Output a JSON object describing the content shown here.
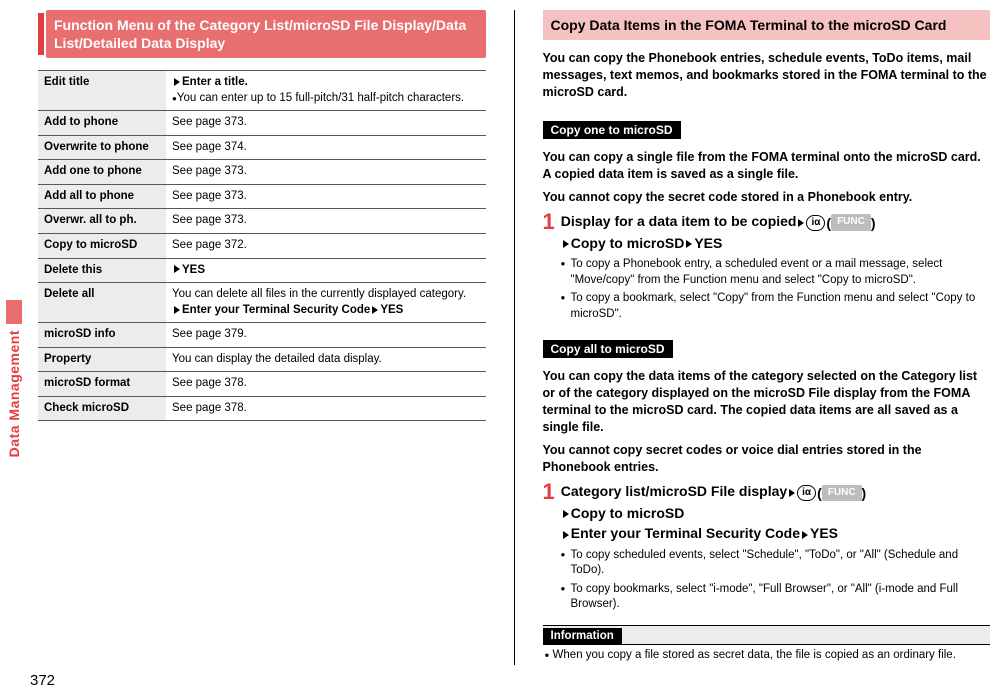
{
  "sideTab": "Data Management",
  "pageNumber": "372",
  "left": {
    "heading": "Function Menu of the Category List/microSD File Display/Data List/Detailed Data Display",
    "rows": [
      {
        "name": "Edit title",
        "desc_strong": "Enter a title.",
        "desc_note": "You can enter up to 15 full-pitch/31 half-pitch characters.",
        "arrow": true,
        "bullet": true
      },
      {
        "name": "Add to phone",
        "desc": "See page 373."
      },
      {
        "name": "Overwrite to phone",
        "desc": "See page 374."
      },
      {
        "name": "Add one to phone",
        "desc": "See page 373."
      },
      {
        "name": "Add all to phone",
        "desc": "See page 373."
      },
      {
        "name": "Overwr. all to ph.",
        "desc": "See page 373."
      },
      {
        "name": "Copy to microSD",
        "desc": "See page 372."
      },
      {
        "name": "Delete this",
        "desc_strong": "YES",
        "arrow": true
      },
      {
        "name": "Delete all",
        "desc": "You can delete all files in the currently displayed category.",
        "desc_strong2": "Enter your Terminal Security Code",
        "desc_strong3": "YES",
        "arrow2": true
      },
      {
        "name": "microSD info",
        "desc": "See page 379."
      },
      {
        "name": "Property",
        "desc": "You can display the detailed data display."
      },
      {
        "name": "microSD format",
        "desc": "See page 378."
      },
      {
        "name": "Check microSD",
        "desc": "See page 378."
      }
    ]
  },
  "right": {
    "heading": "Copy Data Items in the FOMA Terminal to the microSD Card",
    "lead": "You can copy the Phonebook entries, schedule events, ToDo items, mail messages, text memos, and bookmarks stored in the FOMA terminal to the microSD card.",
    "section1": {
      "chip": "Copy one to microSD",
      "para1": "You can copy a single file from the FOMA terminal onto the microSD card. A copied data item is saved as a single file.",
      "para2": "You cannot copy the secret code stored in a Phonebook entry.",
      "step_line1a": "Display for a data item to be copied",
      "step_line2a": "Copy to microSD",
      "step_line2b": "YES",
      "bullets": [
        "To copy a Phonebook entry, a scheduled event or a mail message, select \"Move/copy\" from the Function menu and select \"Copy to microSD\".",
        "To copy a bookmark, select \"Copy\" from the Function menu and select \"Copy to microSD\"."
      ]
    },
    "section2": {
      "chip": "Copy all to microSD",
      "para1": "You can copy the data items of the category selected on the Category list or of the category displayed on the microSD File display from the FOMA terminal to the microSD card. The copied data items are all saved as a single file.",
      "para2": "You cannot copy secret codes or voice dial entries stored in the Phonebook entries.",
      "step_line1a": "Category list/microSD File display",
      "step_line2a": "Copy to microSD",
      "step_line3a": "Enter your Terminal Security Code",
      "step_line3b": "YES",
      "bullets": [
        "To copy scheduled events, select \"Schedule\", \"ToDo\", or \"All\" (Schedule and ToDo).",
        "To copy bookmarks, select \"i-mode\", \"Full Browser\", or \"All\" (i-mode and Full Browser)."
      ]
    },
    "info": {
      "title": "Information",
      "note": "When you copy a file stored as secret data, the file is copied as an ordinary file."
    },
    "funcLabel": "FUNC",
    "ovalChar": "iα"
  }
}
